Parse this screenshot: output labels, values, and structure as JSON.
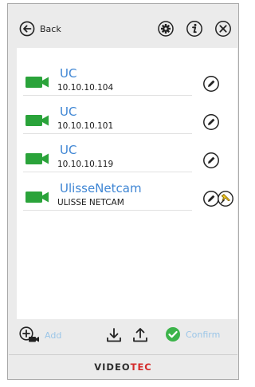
{
  "header": {
    "back_label": "Back"
  },
  "devices": [
    {
      "name": "UC",
      "address": "10.10.10.104",
      "pinned": false
    },
    {
      "name": "UC",
      "address": "10.10.10.101",
      "pinned": false
    },
    {
      "name": "UC",
      "address": "10.10.10.119",
      "pinned": false
    },
    {
      "name": "UlisseNetcam",
      "address": "ULISSE NETCAM",
      "pinned": true
    }
  ],
  "toolbar": {
    "add_label": "Add",
    "confirm_label": "Confirm"
  },
  "footer": {
    "brand_part1": "VIDEO",
    "brand_part2": "TEC"
  },
  "colors": {
    "camera_green": "#2aa33a",
    "name_blue": "#3f86d4",
    "disabled_label": "#9bc6e8",
    "confirm_green": "#3cb44a",
    "brand_red": "#d42a2a",
    "pin_yellow": "#f2c81e"
  },
  "icons": {
    "back": "arrow-left-circle-icon",
    "settings": "gear-icon",
    "info": "info-icon",
    "close": "close-icon",
    "camera": "camera-icon",
    "edit": "pencil-icon",
    "pin": "pin-icon",
    "add": "add-camera-icon",
    "download": "download-icon",
    "upload": "upload-icon",
    "confirm": "check-circle-icon"
  }
}
